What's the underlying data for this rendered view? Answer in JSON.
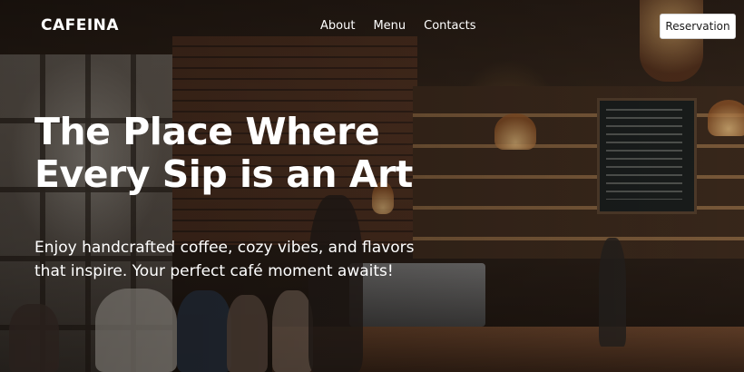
{
  "nav": {
    "logo": "CAFEINA",
    "links": [
      {
        "label": "About"
      },
      {
        "label": "Menu"
      },
      {
        "label": "Contacts"
      }
    ],
    "reservation_label": "Reservation"
  },
  "hero": {
    "title": "The Place Where Every Sip is an Art",
    "subtitle": "Enjoy handcrafted coffee, cozy vibes, and flavors that inspire. Your perfect café moment awaits!"
  }
}
